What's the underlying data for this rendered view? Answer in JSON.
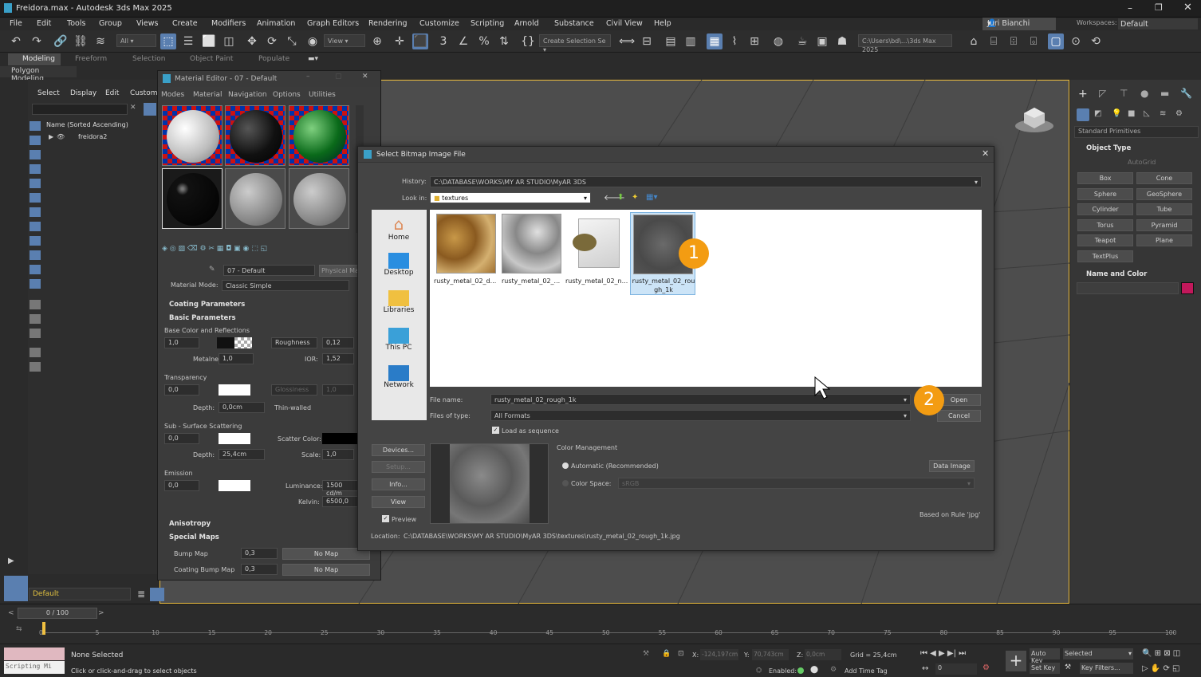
{
  "window": {
    "title": "Freidora.max - Autodesk 3ds Max 2025"
  },
  "menu": [
    "File",
    "Edit",
    "Tools",
    "Group",
    "Views",
    "Create",
    "Modifiers",
    "Animation",
    "Graph Editors",
    "Rendering",
    "Customize",
    "Scripting",
    "Arnold",
    "Substance",
    "Civil View",
    "Help"
  ],
  "user": {
    "name": "Juri Bianchi",
    "workspaces_label": "Workspaces:",
    "workspace": "Default"
  },
  "toolbar": {
    "filter": "All",
    "view": "View",
    "selection_set": "Create Selection Se",
    "path": "C:\\Users\\bd\\...\\3ds Max 2025"
  },
  "ribbon": {
    "tabs": [
      "Modeling",
      "Freeform",
      "Selection",
      "Object Paint",
      "Populate"
    ],
    "sub": "Polygon Modeling"
  },
  "scene_explorer": {
    "menu": [
      "Select",
      "Display",
      "Edit",
      "Custom"
    ],
    "sort_header": "Name (Sorted Ascending)",
    "root": "freidora2",
    "layer": "Default"
  },
  "material_editor": {
    "title": "Material Editor - 07 - Default",
    "menu": [
      "Modes",
      "Material",
      "Navigation",
      "Options",
      "Utilities"
    ],
    "material_name": "07 - Default",
    "material_type": "Physical Mat",
    "mode_label": "Material Mode:",
    "mode": "Classic Simple",
    "sections": {
      "coating": "Coating Parameters",
      "basic": "Basic Parameters",
      "anisotropy": "Anisotropy",
      "special": "Special Maps"
    },
    "base_color_label": "Base Color and Reflections",
    "base_weight": "1,0",
    "roughness_label": "Roughness",
    "roughness": "0,12",
    "metalness_label": "Metalness:",
    "metalness": "1,0",
    "ior_label": "IOR:",
    "ior": "1,52",
    "transparency_label": "Transparency",
    "transparency": "0,0",
    "glossiness_label": "Glossiness",
    "glossiness": "1,0",
    "depth_label": "Depth:",
    "depth": "0,0cm",
    "thin_walled": "Thin-walled",
    "sss_label": "Sub - Surface Scattering",
    "sss": "0,0",
    "scatter_label": "Scatter Color:",
    "sss_depth": "25,4cm",
    "scale_label": "Scale:",
    "scale": "1,0",
    "emission_label": "Emission",
    "emission": "0,0",
    "luminance_label": "Luminance:",
    "luminance": "1500 cd/m",
    "kelvin_label": "Kelvin:",
    "kelvin": "6500,0",
    "bump_label": "Bump Map",
    "bump": "0,3",
    "coat_bump_label": "Coating Bump Map",
    "coat_bump": "0,3",
    "no_map": "No Map"
  },
  "dialog": {
    "title": "Select Bitmap Image File",
    "history_label": "History:",
    "history": "C:\\DATABASE\\WORKS\\MY AR STUDIO\\MyAR 3DS",
    "lookin_label": "Look in:",
    "lookin": "textures",
    "places": [
      "Home",
      "Desktop",
      "Libraries",
      "This PC",
      "Network"
    ],
    "files": [
      {
        "name": "rusty_metal_02_d...",
        "color": "#b08940"
      },
      {
        "name": "rusty_metal_02_...",
        "color": "#9a9a9a"
      },
      {
        "name": "rusty_metal_02_n...",
        "color": "#e8e8e8"
      },
      {
        "name": "rusty_metal_02_rou gh_1k",
        "color": "#5c5c5c"
      }
    ],
    "filename_label": "File name:",
    "filename": "rusty_metal_02_rough_1k",
    "filetype_label": "Files of type:",
    "filetype": "All Formats",
    "open": "Open",
    "cancel": "Cancel",
    "load_sequence": "Load as sequence",
    "devices": "Devices...",
    "setup": "Setup...",
    "info": "Info...",
    "view": "View",
    "preview": "Preview",
    "color_mgmt": "Color Management",
    "automatic": "Automatic (Recommended)",
    "color_space_label": "Color Space:",
    "color_space": "sRGB",
    "data_image": "Data Image",
    "rule": "Based on Rule 'jpg'",
    "location_label": "Location:",
    "location": "C:\\DATABASE\\WORKS\\MY AR STUDIO\\MyAR 3DS\\textures\\rusty_metal_02_rough_1k.jpg"
  },
  "annotations": {
    "one": "1",
    "two": "2"
  },
  "command_panel": {
    "category": "Standard Primitives",
    "object_type": "Object Type",
    "autogrid": "AutoGrid",
    "primitives": [
      "Box",
      "Cone",
      "Sphere",
      "GeoSphere",
      "Cylinder",
      "Tube",
      "Torus",
      "Pyramid",
      "Teapot",
      "Plane",
      "TextPlus"
    ],
    "name_color": "Name and Color",
    "color": "#c2185b"
  },
  "timeline": {
    "frame": "0 / 100",
    "ticks": [
      "0",
      "5",
      "10",
      "15",
      "20",
      "25",
      "30",
      "35",
      "40",
      "45",
      "50",
      "55",
      "60",
      "65",
      "70",
      "75",
      "80",
      "85",
      "90",
      "95",
      "100"
    ]
  },
  "status": {
    "maxscript": "Scripting Mi",
    "selected": "None Selected",
    "prompt": "Click or click-and-drag to select objects",
    "x_label": "X:",
    "x": "-124,197cm",
    "y_label": "Y:",
    "y": "70,743cm",
    "z_label": "Z:",
    "z": "0,0cm",
    "grid": "Grid = 25,4cm",
    "enabled": "Enabled:",
    "add_time_tag": "Add Time Tag",
    "auto_key": "Auto Key",
    "set_key": "Set Key",
    "selected_drop": "Selected",
    "key_filters": "Key Filters...",
    "frame": "0"
  }
}
